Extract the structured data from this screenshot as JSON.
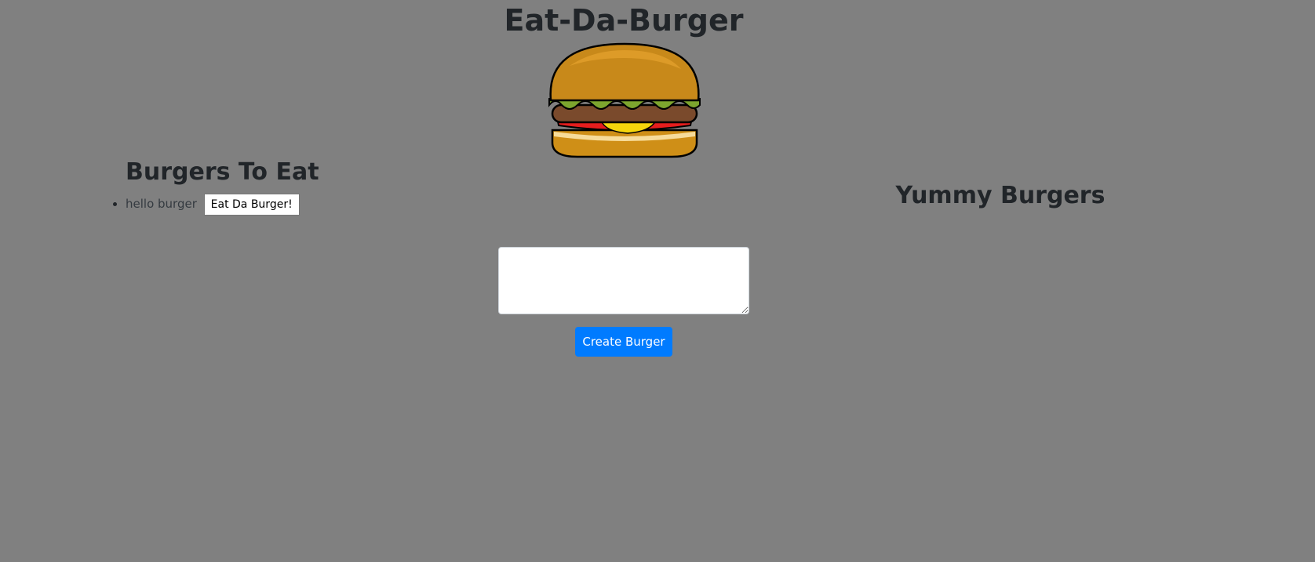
{
  "header": {
    "title": "Eat-Da-Burger",
    "logo_icon": "burger-icon"
  },
  "to_eat": {
    "heading": "Burgers To Eat",
    "items": [
      {
        "name": "hello burger",
        "button_label": "Eat Da Burger!"
      }
    ]
  },
  "eaten": {
    "heading": "Yummy Burgers"
  },
  "form": {
    "textarea_value": "",
    "submit_label": "Create Burger"
  },
  "colors": {
    "background": "#808080",
    "text": "#212529",
    "primary_button": "#007bff",
    "bun": "#c8891a",
    "lettuce": "#7da52e",
    "patty": "#7a4a2c",
    "tomato": "#e51d1d",
    "cheese": "#f5d50c"
  }
}
